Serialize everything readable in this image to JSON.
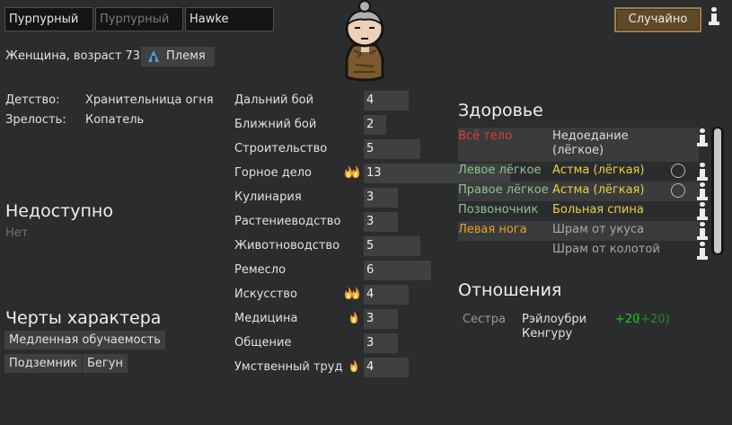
{
  "name": {
    "first": "Пурпурный",
    "nick_placeholder": "Пурпурный",
    "last": "Hawke"
  },
  "randomize_button": "Случайно",
  "summary": "Женщина, возраст 73",
  "faction": {
    "label": "Племя",
    "icon": "tribe-icon",
    "color": "#4aa3e0"
  },
  "backstory": {
    "childhood_label": "Детство:",
    "childhood_value": "Хранительница огня",
    "adulthood_label": "Зрелость:",
    "adulthood_value": "Копатель"
  },
  "incapable": {
    "title": "Недоступно",
    "value": "Нет"
  },
  "traits": {
    "title": "Черты характера",
    "items": [
      "Медленная обучаемость",
      "Подземник",
      "Бегун"
    ]
  },
  "skills": [
    {
      "name": "Дальний бой",
      "level": 4,
      "passion": 0
    },
    {
      "name": "Ближний бой",
      "level": 2,
      "passion": 0
    },
    {
      "name": "Строительство",
      "level": 5,
      "passion": 0
    },
    {
      "name": "Горное дело",
      "level": 13,
      "passion": 2
    },
    {
      "name": "Кулинария",
      "level": 3,
      "passion": 0
    },
    {
      "name": "Растениеводство",
      "level": 3,
      "passion": 0
    },
    {
      "name": "Животноводство",
      "level": 5,
      "passion": 0
    },
    {
      "name": "Ремесло",
      "level": 6,
      "passion": 0
    },
    {
      "name": "Искусство",
      "level": 4,
      "passion": 2
    },
    {
      "name": "Медицина",
      "level": 3,
      "passion": 1
    },
    {
      "name": "Общение",
      "level": 3,
      "passion": 0
    },
    {
      "name": "Умственный труд",
      "level": 4,
      "passion": 1
    }
  ],
  "health": {
    "title": "Здоровье",
    "rows": [
      {
        "part": "Всё тело",
        "condition": "Недоедание (лёгкое)",
        "part_color": "#e03a3a",
        "cond_color": "#dcdcdc"
      },
      {
        "part": "Левое лёгкое",
        "condition": "Астма (лёгкая)",
        "part_color": "#8bc48b",
        "cond_color": "#e8d040"
      },
      {
        "part": "Правое лёгкое",
        "condition": "Астма (лёгкая)",
        "part_color": "#8bc48b",
        "cond_color": "#e8d040"
      },
      {
        "part": "Позвоночник",
        "condition": "Больная спина",
        "part_color": "#8bc48b",
        "cond_color": "#e8d040"
      },
      {
        "part": "Левая нога",
        "condition": "Шрам от укуса",
        "part_color": "#e8a020",
        "cond_color": "#a8a8a8"
      },
      {
        "part": "",
        "condition": "Шрам от колотой",
        "part_color": "#e8a020",
        "cond_color": "#a8a8a8"
      }
    ]
  },
  "relations": {
    "title": "Отношения",
    "items": [
      {
        "relation": "Сестра",
        "name": "Рэйлоубри Кенгуру",
        "opinion": "+20",
        "opinion_base": "(+20)"
      }
    ]
  },
  "colors": {
    "positive": "#27c427",
    "positive_dim": "#1f8f1f",
    "flame": "#f5a623"
  }
}
